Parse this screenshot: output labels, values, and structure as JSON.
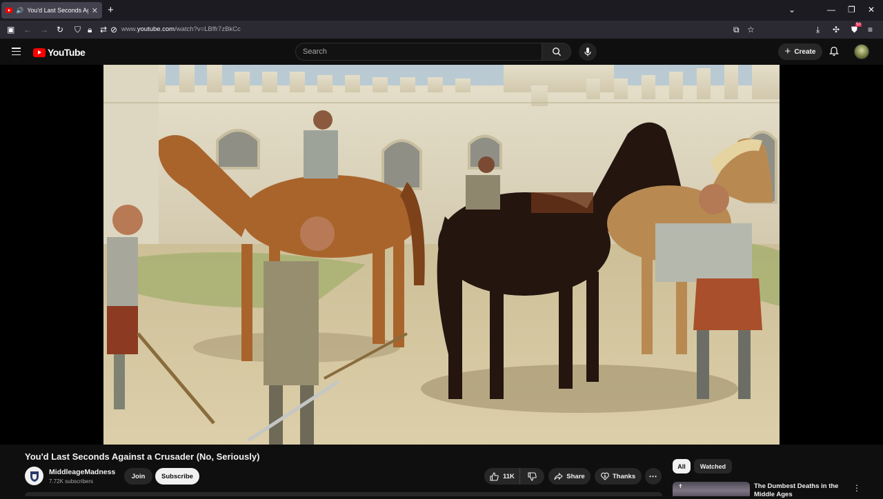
{
  "browser": {
    "tab_title": "You'd Last Seconds Against",
    "new_tab": "+",
    "url_prefix": "www.",
    "url_domain": "youtube.com",
    "url_path": "/watch?v=LBffr7zBkCc",
    "extension_badge": "50"
  },
  "header": {
    "logo_text": "YouTube",
    "search_placeholder": "Search",
    "create_label": "Create"
  },
  "video": {
    "title": "You'd Last Seconds Against a Crusader (No, Seriously)",
    "channel_name": "MiddleageMadness",
    "subscribers": "7.72K subscribers",
    "join_label": "Join",
    "subscribe_label": "Subscribe",
    "like_count": "11K",
    "share_label": "Share",
    "thanks_label": "Thanks"
  },
  "sidebar": {
    "chips": [
      "All",
      "Watched"
    ],
    "active_chip": "All",
    "recommended": [
      {
        "title": "The Dumbest Deaths in the Middle Ages"
      }
    ]
  },
  "colors": {
    "brand_red": "#ff0000",
    "page_bg": "#0f0f0f",
    "pill_bg": "#272727",
    "text": "#f1f1f1",
    "secondary_text": "#aaaaaa"
  }
}
